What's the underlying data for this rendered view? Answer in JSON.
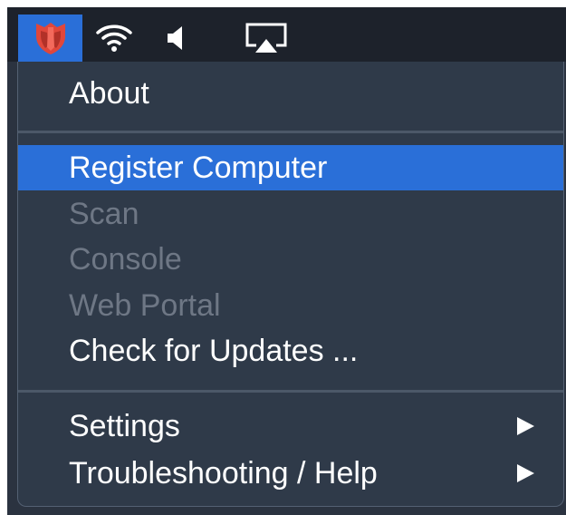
{
  "menubar": {
    "icons": [
      "shield-app-icon",
      "wifi-icon",
      "volume-icon",
      "airplay-icon"
    ]
  },
  "menu": {
    "about": "About",
    "register_computer": "Register Computer",
    "scan": "Scan",
    "console": "Console",
    "web_portal": "Web Portal",
    "check_for_updates": "Check for Updates ...",
    "settings": "Settings",
    "troubleshooting_help": "Troubleshooting / Help",
    "submenu_icon": "submenu-arrow-icon"
  },
  "colors": {
    "menubar": "#1d222b",
    "menu_background": "#2f3a49",
    "highlight": "#2a6fd8",
    "text": "#ffffff",
    "text_disabled": "#6e7785",
    "app_icon": "#e0473b"
  }
}
